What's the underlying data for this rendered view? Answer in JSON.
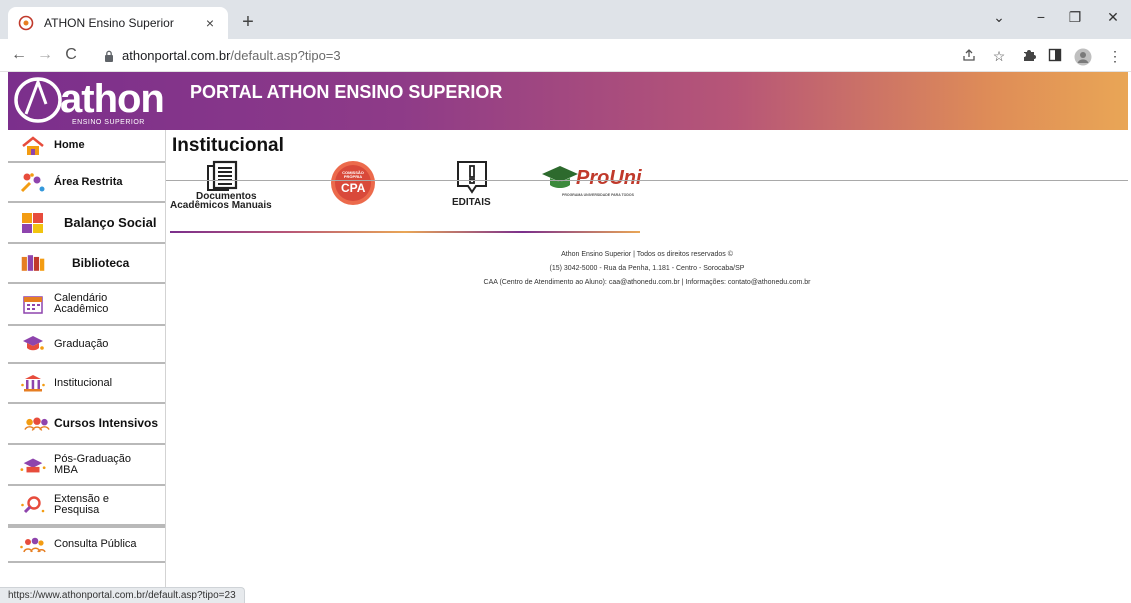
{
  "browser": {
    "tab_title": "ATHON Ensino Superior",
    "tab_close": "×",
    "new_tab": "+",
    "url_host": "athonportal.com.br",
    "url_path": "/default.asp?tipo=3",
    "status_url": "https://www.athonportal.com.br/default.asp?tipo=23",
    "controls": {
      "dropdown": "⌄",
      "minimize": "−",
      "restore": "❐",
      "close": "✕"
    },
    "nav": {
      "back": "←",
      "forward": "→",
      "reload": "C"
    }
  },
  "header": {
    "logo_word": "athon",
    "logo_sub": "ENSINO SUPERIOR",
    "title": "PORTAL ATHON ENSINO SUPERIOR"
  },
  "sidebar": {
    "items": [
      {
        "label": "Home",
        "icon": "house-icon"
      },
      {
        "label": "Área Restrita",
        "icon": "users-icon"
      },
      {
        "label": "Balanço Social",
        "icon": "puzzle-icon"
      },
      {
        "label": "Biblioteca",
        "icon": "books-icon"
      },
      {
        "label": "Calendário Acadêmico",
        "icon": "calendar-icon"
      },
      {
        "label": "Graduação",
        "icon": "grad-cap-icon"
      },
      {
        "label": "Institucional",
        "icon": "building-icon"
      },
      {
        "label": "Cursos Intensivos",
        "icon": "people-icon"
      },
      {
        "label": "Pós-Graduação MBA",
        "icon": "mba-icon"
      },
      {
        "label": "Extensão e Pesquisa",
        "icon": "magnifier-icon"
      },
      {
        "label": "Consulta Pública",
        "icon": "crowd-icon"
      }
    ]
  },
  "main": {
    "title": "Institucional",
    "cards": {
      "documentos_1": "Documentos",
      "documentos_2": "Acadêmicos Manuais",
      "cpa_small": "COMISSÃO PRÓPRIA",
      "cpa_big": "CPA",
      "editais": "EDITAIS",
      "prouni": "ProUni",
      "prouni_sub": "PROGRAMA UNIVERSIDADE PARA TODOS"
    }
  },
  "footer": {
    "line1": "Athon Ensino Superior | Todos os direitos reservados ©",
    "line2": "(15) 3042-5000 - Rua da Penha, 1.181 - Centro - Sorocaba/SP",
    "line3": "CAA (Centro de Atendimento ao Aluno): caa@athonedu.com.br | Informações: contato@athonedu.com.br"
  },
  "colors": {
    "banner_start": "#7b2f8c",
    "banner_end": "#e9a656",
    "tabbar": "#dfe3e8"
  }
}
